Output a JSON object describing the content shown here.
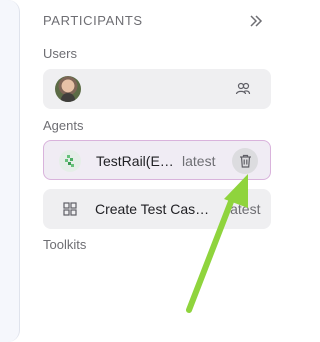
{
  "participants": {
    "title": "PARTICIPANTS",
    "collapse_icon": "double-chevron-right-icon"
  },
  "users": {
    "label": "Users",
    "avatar_icon": "avatar",
    "add_icon": "users-icon"
  },
  "agents": {
    "label": "Agents",
    "items": [
      {
        "name": "TestRail(E…",
        "version": "latest",
        "icon": "testrail-logo-icon",
        "selected": true
      },
      {
        "name": "Create Test Cas…",
        "version": "latest",
        "icon": "grid-icon",
        "selected": false
      }
    ]
  },
  "toolkits": {
    "label": "Toolkits"
  },
  "annotation": {
    "color": "#8fd43d",
    "points_to": "delete-button"
  }
}
